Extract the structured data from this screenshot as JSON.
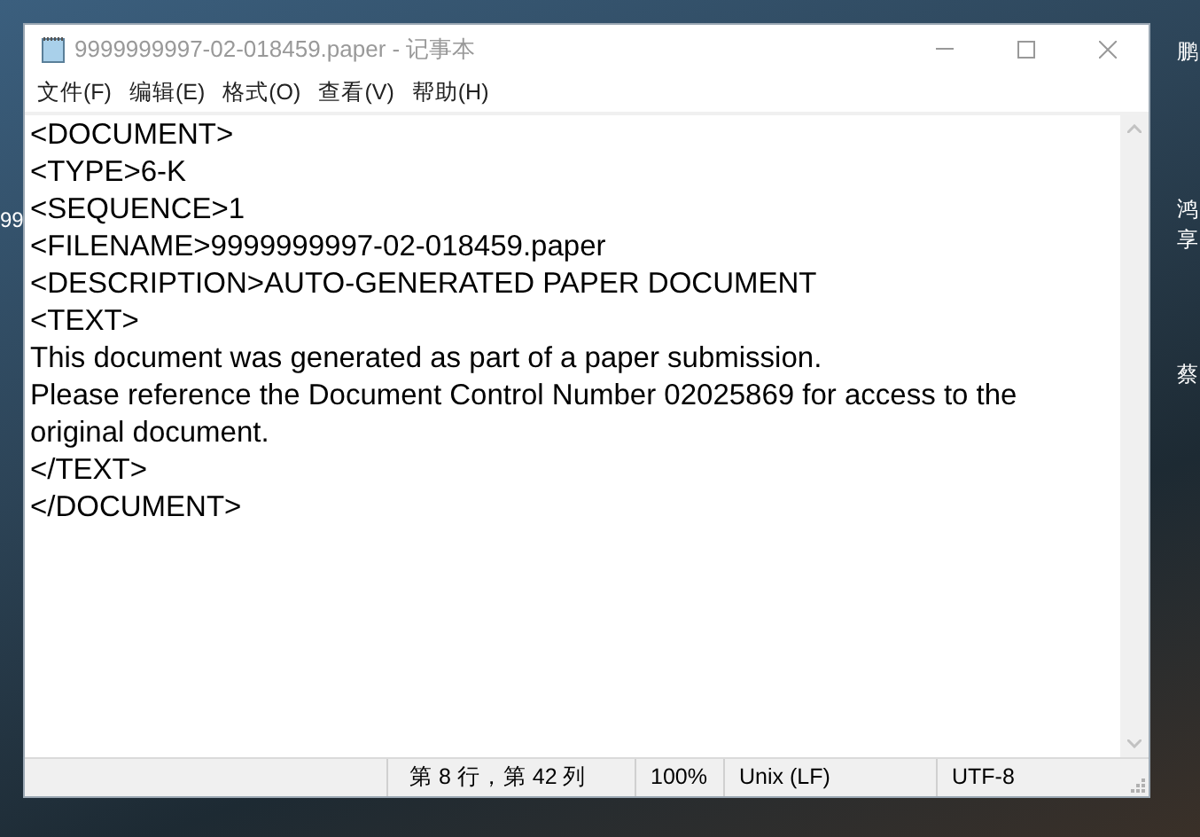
{
  "desktop_labels": [
    {
      "text": "99"
    },
    {
      "text": "鹏"
    },
    {
      "text": "鸿"
    },
    {
      "text": "享"
    },
    {
      "text": "蔡"
    }
  ],
  "window": {
    "title": "9999999997-02-018459.paper - 记事本",
    "menu": [
      "文件(F)",
      "编辑(E)",
      "格式(O)",
      "查看(V)",
      "帮助(H)"
    ],
    "lines": [
      "<DOCUMENT>",
      "<TYPE>6-K",
      "<SEQUENCE>1",
      "<FILENAME>9999999997-02-018459.paper",
      "<DESCRIPTION>AUTO-GENERATED PAPER DOCUMENT",
      "<TEXT>",
      "This document was generated as part of a paper submission.",
      "Please reference the Document Control Number 02025869 for access to the",
      "original document.",
      "</TEXT>",
      "</DOCUMENT>"
    ],
    "status_bar": {
      "position": "第 8 行，第 42 列",
      "zoom": "100%",
      "line_ending": "Unix (LF)",
      "encoding": "UTF-8"
    }
  }
}
